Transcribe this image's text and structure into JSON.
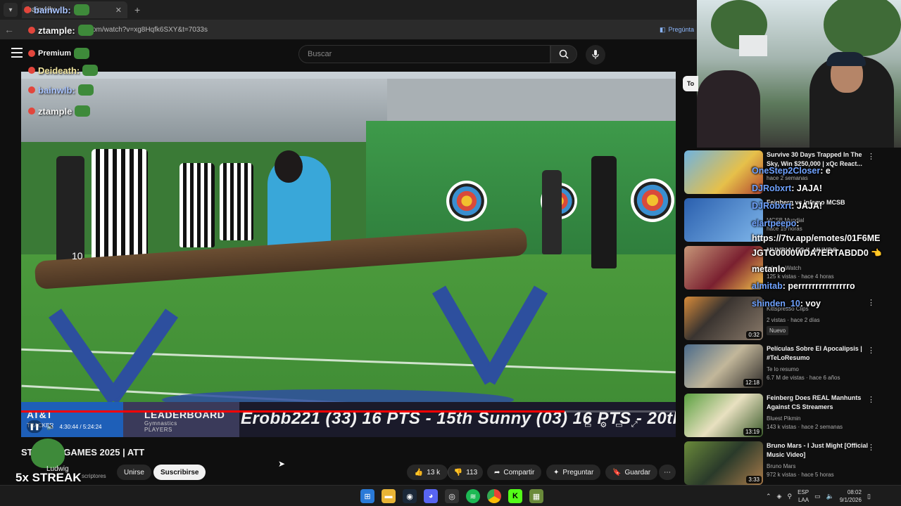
{
  "browser": {
    "tab_title": "bainwlb:",
    "address": "com/watch?v=xg8Hqfk6SXY&t=7033s",
    "ask_label": "Pregúnta"
  },
  "youtube": {
    "search_placeholder": "Buscar",
    "video_title": "ST",
    "video_title_tail": "GAMES 2025 | ATT",
    "channel_name": "Ludwig",
    "channel_subs": "scriptores",
    "join_label": "Unirse",
    "subscribe_label": "Suscribirse",
    "likes": "13 k",
    "dislikes": "113",
    "share_label": "Compartir",
    "ask_label": "Preguntar",
    "save_label": "Guardar",
    "chip_label": "To"
  },
  "player": {
    "progress": 0.83,
    "time": "4:30:44 / 5:24:24",
    "ticker_logo": "AT&T",
    "ticker_logo_sub": "TRACKER",
    "ticker_heading": "LEADERBOARD",
    "ticker_sub": "Gymnastics",
    "ticker_sub2": "PLAYERS",
    "ticker_text": "Erobb221 (33) 16 PTS - 15th Sunny (03) 16 PTS - 20th MARI (0",
    "overlay_number": "10"
  },
  "left_chat": [
    {
      "user": "bainwlb:"
    },
    {
      "user": "ztample:"
    },
    {
      "user": "Premium"
    },
    {
      "user": "Deideath:"
    },
    {
      "user": "bainwlb:"
    },
    {
      "user": "ztample"
    }
  ],
  "streak_text": "5x STREAK",
  "recommendations": [
    {
      "title": "Survive 30 Days Trapped In The Sky, Win $250,000 | xQc React...",
      "meta1": "",
      "meta2": "hace 2 semanas",
      "duration": ""
    },
    {
      "title": "Feinberg vs Infamo MCSB",
      "meta1": "MCSB Mundial",
      "meta2": "hace 15 horas",
      "duration": ""
    },
    {
      "title": "MUNDIALES IL MUNDO",
      "meta1": "Infamo Watch",
      "meta2": "125 k vistas · hace 4 horas",
      "duration": ""
    },
    {
      "title": "",
      "meta1": "Kittspresso Clips",
      "meta2": "2 vistas · hace 2 días",
      "duration": "0:32",
      "badge": "Nuevo"
    },
    {
      "title": "Películas Sobre El Apocalipsis | #TeLoResumo",
      "meta1": "Te lo resumo",
      "meta2": "6.7 M de vistas · hace 6 años",
      "duration": "12:18"
    },
    {
      "title": "Feinberg Does REAL Manhunts Against CS Streamers",
      "meta1": "Bluest Pikmin",
      "meta2": "143 k vistas · hace 2 semanas",
      "duration": "13:19"
    },
    {
      "title": "Bruno Mars - I Just Might [Official Music Video]",
      "meta1": "Bruno Mars",
      "meta2": "972 k vistas · hace 5 horas",
      "duration": "3:33"
    }
  ],
  "right_chat": [
    {
      "user": "OneStep2Closer",
      "msg": ": e"
    },
    {
      "user": "DJRobxrt",
      "msg": ":       JAJA!"
    },
    {
      "user": "DJRobxrt",
      "msg": ":       JAJA!"
    },
    {
      "user": "elartpeepo",
      "msg": ":"
    },
    {
      "user": "",
      "msg": "https://7tv.app/emotes/01F6ME"
    },
    {
      "user": "",
      "msg": "JGTG0000WDA7ERTABDD0 👈"
    },
    {
      "user": "",
      "msg": "  metanlo"
    },
    {
      "user": "almitab",
      "msg": ": perrrrrrrrrrrrrrro"
    },
    {
      "user": "shinden_10",
      "msg": ": voy"
    }
  ],
  "tray": {
    "lang": "ESP",
    "lang2": "LAA",
    "time": "08:02",
    "date": "9/1/2026"
  },
  "colors": {
    "accent": "#ff0000",
    "chat_user": "#6fa2ff"
  }
}
